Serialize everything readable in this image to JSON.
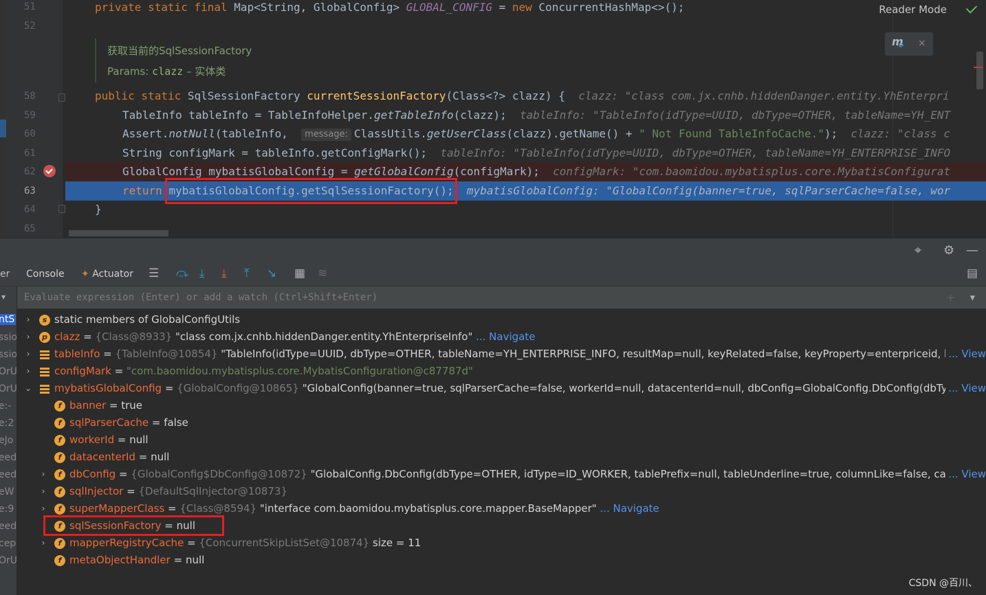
{
  "editor": {
    "line_numbers": [
      "51",
      "52",
      "58",
      "59",
      "60",
      "61",
      "62",
      "63",
      "64",
      "65"
    ],
    "current_line": "63",
    "lines": {
      "l51": {
        "kw": "private static final ",
        "type": "Map<String, GlobalConfig> ",
        "const": "GLOBAL_CONFIG",
        "eq": " = ",
        "new_kw": "new ",
        "rest": "ConcurrentHashMap<>();"
      },
      "l58": {
        "kw": "public static ",
        "type": "SqlSessionFactory ",
        "fn": "currentSessionFactory",
        "args": "(Class<?> clazz) {",
        "hint": "clazz: \"class com.jx.cnhb.hiddenDanger.entity.YhEnterpri"
      },
      "l59": {
        "pre": "TableInfo tableInfo = TableInfoHelper.",
        "call": "getTableInfo",
        "post": "(clazz);",
        "hint": "tableInfo: \"TableInfo(idType=UUID, dbType=OTHER, tableName=YH_ENT"
      },
      "l60": {
        "pre": "Assert.",
        "call": "notNull",
        "mid": "(tableInfo, ",
        "param": "message:",
        "mid2": "ClassUtils.",
        "call2": "getUserClass",
        "mid3": "(clazz).getName() + ",
        "str": "\" Not Found TableInfoCache.\"",
        "post": ");",
        "hint": "clazz: \"class c"
      },
      "l61": {
        "pre": "String configMark = tableInfo.getConfigMark();",
        "hint": "tableInfo: \"TableInfo(idType=UUID, dbType=OTHER, tableName=YH_ENTERPRISE_INFO"
      },
      "l62": {
        "pre": "GlobalConfig mybatisGlobalConfig = ",
        "call": "getGlobalConfig",
        "post": "(configMark);",
        "hint": "configMark: \"com.baomidou.mybatisplus.core.MybatisConfigurat"
      },
      "l63": {
        "kw": "return ",
        "expr": "mybatisGlobalConfig.getSqlSessionFactory();",
        "hint": "mybatisGlobalConfig: \"GlobalConfig(banner=true, sqlParserCache=false, wor"
      },
      "l64": {
        "text": "}"
      }
    },
    "doc": {
      "summary": "获取当前的SqlSessionFactory",
      "params_label": "Params: ",
      "param_name": "clazz",
      "param_desc": " – 实体类"
    },
    "reader_mode": "Reader Mode",
    "plugin_icon": "m",
    "plugin_close": "×"
  },
  "debug": {
    "left_tab_fragment": "er",
    "tabs": [
      "Console",
      "Actuator"
    ],
    "eval_placeholder": "Evaluate expression (Enter) or add a watch (Ctrl+Shift+Enter)",
    "frames": [
      "ntS",
      "ssio",
      "ssio",
      "OrU",
      "OrU",
      "e:-",
      "e:2",
      "eJo",
      "eed",
      "eed",
      "eW",
      "e:9",
      "eed",
      "cep",
      "OrU"
    ],
    "variables": [
      {
        "depth": 0,
        "arrow": "›",
        "icon": "s",
        "name": "static members of GlobalConfigUtils",
        "eq": "",
        "type": "",
        "value": "",
        "link": "",
        "view": ""
      },
      {
        "depth": 0,
        "arrow": "›",
        "icon": "p",
        "name": "clazz",
        "eq": " = ",
        "type": "{Class@8933} ",
        "value": "\"class com.jx.cnhb.hiddenDanger.entity.YhEnterpriseInfo\"",
        "link": " ... Navigate",
        "view": ""
      },
      {
        "depth": 0,
        "arrow": "›",
        "icon": "list",
        "name": "tableInfo",
        "eq": " = ",
        "type": "{TableInfo@10854} ",
        "value": "\"TableInfo(idType=UUID, dbType=OTHER, tableName=YH_ENTERPRISE_INFO, resultMap=null, keyRelated=false, keyProperty=enterpriceid, keyColumn=enterpriceid, keySequence=null)\"",
        "link": "",
        "view": "... View"
      },
      {
        "depth": 0,
        "arrow": "›",
        "icon": "list",
        "name": "configMark",
        "eq": " = ",
        "type": "",
        "value": "\"com.baomidou.mybatisplus.core.MybatisConfiguration@c87787d\"",
        "link": "",
        "view": "",
        "strval": true
      },
      {
        "depth": 0,
        "arrow": "⌄",
        "icon": "list",
        "name": "mybatisGlobalConfig",
        "eq": " = ",
        "type": "{GlobalConfig@10865} ",
        "value": "\"GlobalConfig(banner=true, sqlParserCache=false, workerId=null, datacenterId=null, dbConfig=GlobalConfig.DbConfig(dbType=OTHER, idType=ID_WORKER))\"",
        "link": "",
        "view": "... View"
      },
      {
        "depth": 1,
        "arrow": "",
        "icon": "f",
        "name": "banner",
        "eq": " = ",
        "type": "",
        "value": "true",
        "link": "",
        "view": ""
      },
      {
        "depth": 1,
        "arrow": "",
        "icon": "f",
        "name": "sqlParserCache",
        "eq": " = ",
        "type": "",
        "value": "false",
        "link": "",
        "view": ""
      },
      {
        "depth": 1,
        "arrow": "",
        "icon": "f",
        "name": "workerId",
        "eq": " = ",
        "type": "",
        "value": "null",
        "link": "",
        "view": ""
      },
      {
        "depth": 1,
        "arrow": "",
        "icon": "f",
        "name": "datacenterId",
        "eq": " = ",
        "type": "",
        "value": "null",
        "link": "",
        "view": ""
      },
      {
        "depth": 1,
        "arrow": "›",
        "icon": "f",
        "name": "dbConfig",
        "eq": " = ",
        "type": "{GlobalConfig$DbConfig@10872} ",
        "value": "\"GlobalConfig.DbConfig(dbType=OTHER, idType=ID_WORKER, tablePrefix=null, tableUnderline=true, columnLike=false, capitalMode=false)\"",
        "link": "",
        "view": "... View"
      },
      {
        "depth": 1,
        "arrow": "›",
        "icon": "f",
        "name": "sqlInjector",
        "eq": " = ",
        "type": "{DefaultSqlInjector@10873}",
        "value": "",
        "link": "",
        "view": ""
      },
      {
        "depth": 1,
        "arrow": "›",
        "icon": "f",
        "name": "superMapperClass",
        "eq": " = ",
        "type": "{Class@8594} ",
        "value": "\"interface com.baomidou.mybatisplus.core.mapper.BaseMapper\"",
        "link": " ... Navigate",
        "view": ""
      },
      {
        "depth": 1,
        "arrow": "",
        "icon": "f",
        "name": "sqlSessionFactory",
        "eq": " = ",
        "type": "",
        "value": "null",
        "link": "",
        "view": ""
      },
      {
        "depth": 1,
        "arrow": "›",
        "icon": "f",
        "name": "mapperRegistryCache",
        "eq": " = ",
        "type": "{ConcurrentSkipListSet@10874} ",
        "value": " size = 11",
        "link": "",
        "view": ""
      },
      {
        "depth": 1,
        "arrow": "",
        "icon": "f",
        "name": "metaObjectHandler",
        "eq": " = ",
        "type": "",
        "value": "null",
        "link": "",
        "view": ""
      }
    ]
  },
  "watermark": "CSDN @百川、"
}
